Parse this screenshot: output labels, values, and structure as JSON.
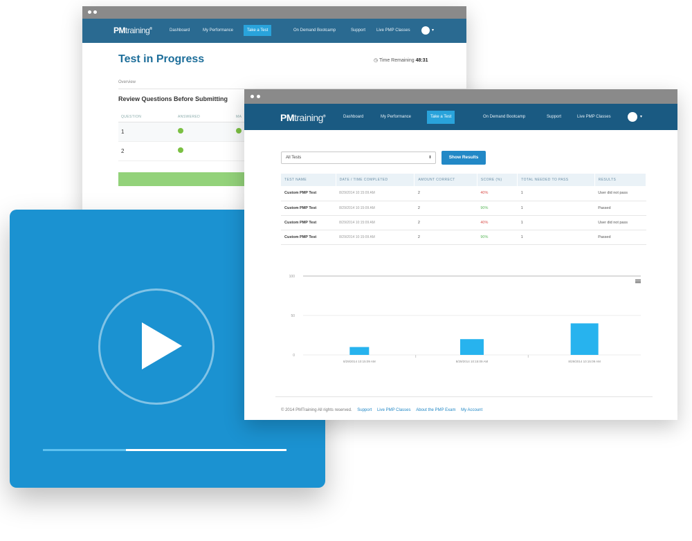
{
  "nav": {
    "logo_bold": "PM",
    "logo_light": "training",
    "logo_mark": "®",
    "dashboard": "Dashboard",
    "my_performance": "My Performance",
    "take_a_test": "Take a Test",
    "bootcamp": "On Demand Bootcamp",
    "support": "Support",
    "live_classes": "Live PMP Classes",
    "caret": "▾"
  },
  "back_window": {
    "title": "Test in Progress",
    "time_label": "Time Remaining",
    "time_value": "48:31",
    "overview": "Overview",
    "review_heading": "Review Questions Before Submitting",
    "columns": [
      "QUESTION",
      "ANSWERED",
      "MA"
    ],
    "questions": [
      {
        "number": "1",
        "answered": true
      },
      {
        "number": "2",
        "answered": true
      }
    ]
  },
  "video": {
    "progress_fraction": 0.34
  },
  "front_window": {
    "select_value": "All Tests",
    "select_arrow": "⬍",
    "show_results": "Show Results",
    "table": {
      "headers": [
        "TEST NAME",
        "DATE / TIME COMPLETED",
        "AMOUNT CORRECT",
        "SCORE (%)",
        "TOTAL NEEDED TO PASS",
        "RESULTS"
      ],
      "rows": [
        {
          "name": "Custom PMP Test",
          "date": "8/29/2014 10:15:09 AM",
          "correct": "2",
          "score": "40%",
          "needed": "1",
          "result": "User did not pass",
          "passed": false
        },
        {
          "name": "Custom PMP Test",
          "date": "8/29/2014 10:15:09 AM",
          "correct": "2",
          "score": "90%",
          "needed": "1",
          "result": "Passed",
          "passed": true
        },
        {
          "name": "Custom PMP Test",
          "date": "8/29/2014 10:15:09 AM",
          "correct": "2",
          "score": "40%",
          "needed": "1",
          "result": "User did not pass",
          "passed": false
        },
        {
          "name": "Custom PMP Test",
          "date": "8/29/2014 10:15:09 AM",
          "correct": "2",
          "score": "90%",
          "needed": "1",
          "result": "Passed",
          "passed": true
        }
      ]
    },
    "footer": {
      "copyright": "© 2014 PMTraining All rights reserved.",
      "links": [
        "Support",
        "Live PMP Classes",
        "About the PMP Exam",
        "My Account"
      ]
    }
  },
  "chart_data": {
    "type": "bar",
    "categories": [
      "8/29/2014 10:15:09 AM",
      "8/29/2014 10:15:09 AM",
      "8/29/2014 10:15:09 AM"
    ],
    "values": [
      10,
      20,
      40
    ],
    "yticks": [
      "100",
      "50",
      "0"
    ],
    "ylim": [
      0,
      100
    ],
    "grid": true,
    "bar_color": "#27b3ee",
    "menu_icon": "hamburger-menu-icon"
  },
  "colors": {
    "nav": "#1a5a82",
    "accent": "#2288c6",
    "video_bg": "#1b92d1",
    "pass": "#5cb85c",
    "fail": "#d9534f"
  }
}
